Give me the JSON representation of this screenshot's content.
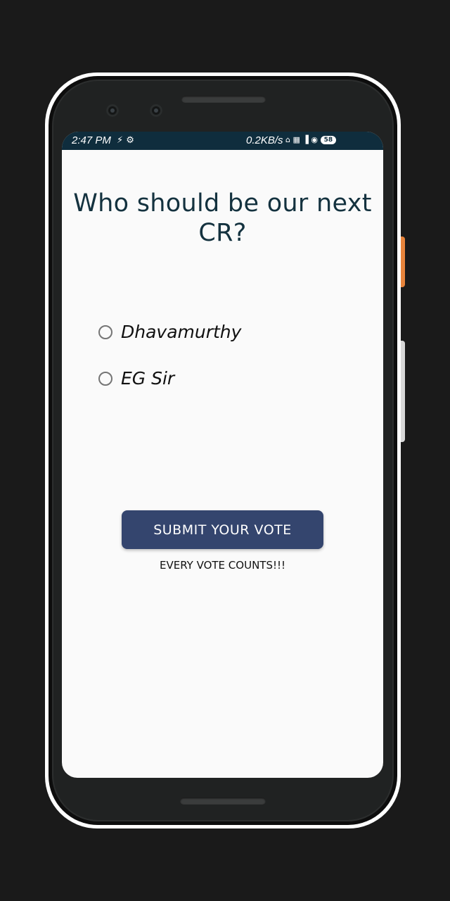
{
  "status_bar": {
    "time": "2:47 PM",
    "left_icons": "⚡ ⚙",
    "network_speed": "0.2KB/s",
    "right_icons": "⌂ ▦ ▐ ◉",
    "battery": "58"
  },
  "poll": {
    "question": "Who should be our next CR?",
    "options": [
      {
        "label": "Dhavamurthy",
        "selected": false
      },
      {
        "label": "EG Sir",
        "selected": false
      }
    ],
    "submit_label": "SUBMIT YOUR VOTE",
    "tagline": "EVERY VOTE COUNTS!!!"
  },
  "colors": {
    "status_bar": "#0f2d3d",
    "title": "#14323f",
    "button": "#34456e",
    "screen_bg": "#fafafa",
    "side_button_accent": "#e8843c"
  }
}
